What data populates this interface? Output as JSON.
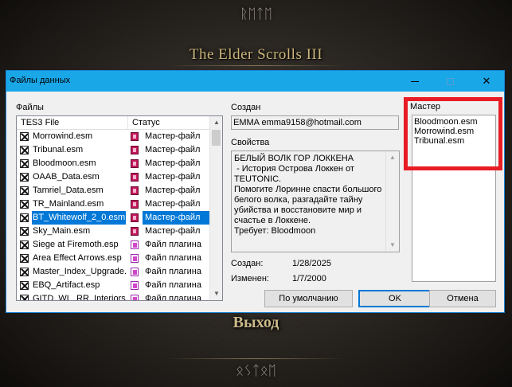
{
  "background": {
    "game_title": "The Elder Scrolls III",
    "rune_top": "ᚱᛖᛏᛖ",
    "menu_item": "Выход",
    "rune_bottom": "ᛟᛊᛏᛟᛖ"
  },
  "window": {
    "title": "Файлы данных",
    "controls": {
      "minimize": "—",
      "maximize": "□",
      "close": "✕"
    }
  },
  "files": {
    "label": "Файлы",
    "columns": {
      "file": "TES3 File",
      "status": "Статус"
    },
    "rows": [
      {
        "name": "Morrowind.esm",
        "status": "Мастер-файл",
        "icon": "master-file-icon",
        "selected": false
      },
      {
        "name": "Tribunal.esm",
        "status": "Мастер-файл",
        "icon": "master-file-icon",
        "selected": false
      },
      {
        "name": "Bloodmoon.esm",
        "status": "Мастер-файл",
        "icon": "master-file-icon",
        "selected": false
      },
      {
        "name": "OAAB_Data.esm",
        "status": "Мастер-файл",
        "icon": "master-file-icon",
        "selected": false
      },
      {
        "name": "Tamriel_Data.esm",
        "status": "Мастер-файл",
        "icon": "master-file-icon",
        "selected": false
      },
      {
        "name": "TR_Mainland.esm",
        "status": "Мастер-файл",
        "icon": "master-file-icon",
        "selected": false
      },
      {
        "name": "BT_Whitewolf_2_0.esm",
        "status": "Мастер-файл",
        "icon": "master-file-icon",
        "selected": true
      },
      {
        "name": "Sky_Main.esm",
        "status": "Мастер-файл",
        "icon": "master-file-icon",
        "selected": false
      },
      {
        "name": "Siege at Firemoth.esp",
        "status": "Файл плагина",
        "icon": "plugin-file-icon",
        "selected": false
      },
      {
        "name": "Area Effect Arrows.esp",
        "status": "Файл плагина",
        "icon": "plugin-file-icon",
        "selected": false
      },
      {
        "name": "Master_Index_Upgrade.esp",
        "status": "Файл плагина",
        "icon": "plugin-file-icon",
        "selected": false
      },
      {
        "name": "EBQ_Artifact.esp",
        "status": "Файл плагина",
        "icon": "plugin-file-icon",
        "selected": false
      },
      {
        "name": "GITD_WL_RR_Interiors.esp",
        "status": "Файл плагина",
        "icon": "plugin-file-icon",
        "selected": false
      }
    ]
  },
  "details": {
    "created_by_label": "Создан",
    "created_by_value": "EMMA emma9158@hotmail.com",
    "properties_label": "Свойства",
    "properties_text": "БЕЛЫЙ ВОЛК ГОР ЛОККЕНА\n - История Острова Локкен от TEUTONIC.\nПомогите Лоринне спасти большого белого волка, разгадайте тайну убийства и восстановите мир и счастье в Локкене.\nТребует: Bloodmoon",
    "created_label": "Создан:",
    "created_date": "1/28/2025",
    "modified_label": "Изменен:",
    "modified_date": "1/7/2000"
  },
  "masters": {
    "label": "Мастер",
    "items": [
      "Bloodmoon.esm",
      "Morrowind.esm",
      "Tribunal.esm"
    ]
  },
  "buttons": {
    "default": "По умолчанию",
    "ok": "OK",
    "cancel": "Отмена"
  },
  "colors": {
    "titlebar": "#1aa7e8",
    "selection": "#0078d7",
    "highlight_box": "#e81c24",
    "master_icon": "#c2185b",
    "plugin_icon": "#d146c9"
  }
}
